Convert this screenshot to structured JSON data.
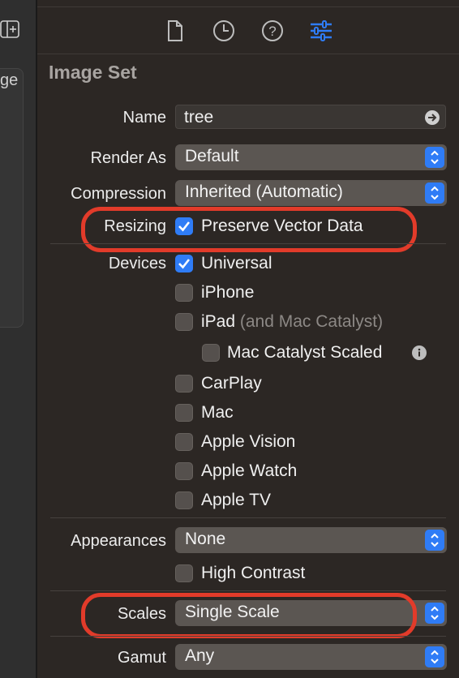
{
  "left_pane": {
    "partial_text": "ge"
  },
  "tabs": [
    {
      "icon": "file-icon"
    },
    {
      "icon": "history-icon"
    },
    {
      "icon": "help-icon"
    },
    {
      "icon": "attributes-inspector-icon",
      "active": true
    }
  ],
  "section_title": "Image Set",
  "name": {
    "label": "Name",
    "value": "tree"
  },
  "render_as": {
    "label": "Render As",
    "value": "Default"
  },
  "compression": {
    "label": "Compression",
    "value": "Inherited (Automatic)"
  },
  "resizing": {
    "label": "Resizing",
    "checkbox_label": "Preserve Vector Data",
    "checked": true
  },
  "devices": {
    "label": "Devices",
    "items": [
      {
        "label": "Universal",
        "note": "",
        "checked": true
      },
      {
        "label": "iPhone",
        "note": "",
        "checked": false
      },
      {
        "label": "iPad",
        "note": "(and Mac Catalyst)",
        "checked": false
      },
      {
        "label": "Mac Catalyst Scaled",
        "note": "",
        "checked": false
      },
      {
        "label": "CarPlay",
        "note": "",
        "checked": false
      },
      {
        "label": "Mac",
        "note": "",
        "checked": false
      },
      {
        "label": "Apple Vision",
        "note": "",
        "checked": false
      },
      {
        "label": "Apple Watch",
        "note": "",
        "checked": false
      },
      {
        "label": "Apple TV",
        "note": "",
        "checked": false
      }
    ]
  },
  "appearances": {
    "label": "Appearances",
    "value": "None",
    "high_contrast_label": "High Contrast",
    "high_contrast_checked": false
  },
  "scales": {
    "label": "Scales",
    "value": "Single Scale"
  },
  "gamut": {
    "label": "Gamut",
    "value": "Any"
  },
  "colors": {
    "accent": "#2f7cf6",
    "highlight": "#e23b2a"
  }
}
